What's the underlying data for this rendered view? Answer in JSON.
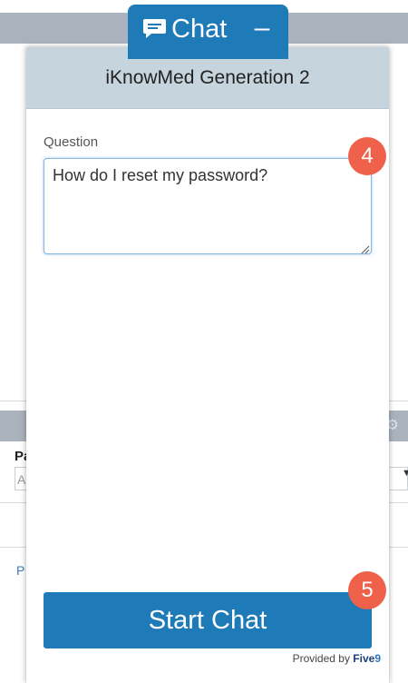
{
  "chat_tab": {
    "title": "Chat",
    "minimize_label": "–",
    "icon": "chat-bubble-icon"
  },
  "chat_window": {
    "header_title": "iKnowMed Generation 2",
    "question_label": "Question",
    "question_value": "How do I reset my password?",
    "start_button_label": "Start Chat",
    "provided_by_label": "Provided by ",
    "brand_five": "Five",
    "brand_nine": "9"
  },
  "callouts": {
    "first": "4",
    "second": "5"
  },
  "background_page": {
    "label_fragment": "Pa",
    "input_fragment": "A",
    "link_fragment": "P",
    "header_icon": "settings-icon"
  },
  "colors": {
    "accent_blue": "#1f7ab8",
    "header_bg": "#c5d4dd",
    "callout_red": "#f0614b"
  }
}
